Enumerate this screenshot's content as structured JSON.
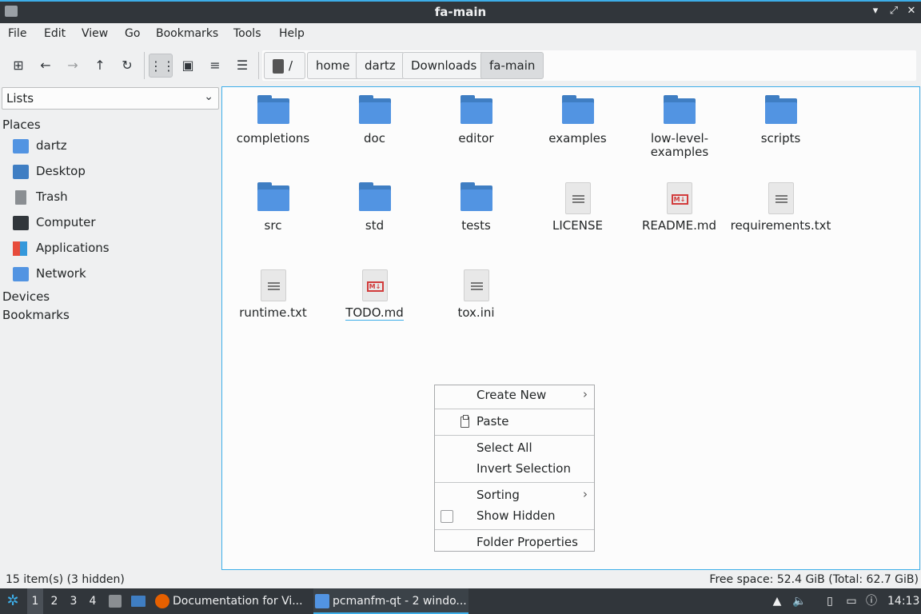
{
  "window": {
    "title": "fa-main"
  },
  "menu": {
    "items": [
      "File",
      "Edit",
      "View",
      "Go",
      "Bookmarks",
      "Tools",
      "Help"
    ]
  },
  "toolbar": {
    "buttons": [
      "new-tab-icon",
      "back-icon",
      "forward-icon",
      "up-icon",
      "reload-icon",
      "icon-view-icon",
      "thumbnail-view-icon",
      "compact-view-icon",
      "detailed-view-icon"
    ],
    "path": [
      "/",
      "home",
      "dartz",
      "Downloads",
      "fa-main"
    ]
  },
  "sidebar": {
    "selector": "Lists",
    "places_label": "Places",
    "places": [
      {
        "label": "dartz",
        "icon": "home-folder-icon"
      },
      {
        "label": "Desktop",
        "icon": "desktop-icon"
      },
      {
        "label": "Trash",
        "icon": "trash-icon"
      },
      {
        "label": "Computer",
        "icon": "computer-icon"
      },
      {
        "label": "Applications",
        "icon": "applications-icon"
      },
      {
        "label": "Network",
        "icon": "network-icon"
      }
    ],
    "devices_label": "Devices",
    "bookmarks_label": "Bookmarks"
  },
  "files": [
    {
      "name": "completions",
      "type": "folder"
    },
    {
      "name": "doc",
      "type": "folder"
    },
    {
      "name": "editor",
      "type": "folder"
    },
    {
      "name": "examples",
      "type": "folder"
    },
    {
      "name": "low-level-examples",
      "type": "folder"
    },
    {
      "name": "scripts",
      "type": "folder"
    },
    {
      "name": "src",
      "type": "folder"
    },
    {
      "name": "std",
      "type": "folder"
    },
    {
      "name": "tests",
      "type": "folder"
    },
    {
      "name": "LICENSE",
      "type": "text"
    },
    {
      "name": "README.md",
      "type": "markdown"
    },
    {
      "name": "requirements.txt",
      "type": "text"
    },
    {
      "name": "runtime.txt",
      "type": "text"
    },
    {
      "name": "TODO.md",
      "type": "markdown"
    },
    {
      "name": "tox.ini",
      "type": "text"
    }
  ],
  "context_menu": {
    "create_new": "Create New",
    "paste": "Paste",
    "select_all": "Select All",
    "invert_selection": "Invert Selection",
    "sorting": "Sorting",
    "show_hidden": "Show Hidden",
    "folder_properties": "Folder Properties"
  },
  "status": {
    "left": "15 item(s) (3 hidden)",
    "right": "Free space: 52.4 GiB (Total: 62.7 GiB)"
  },
  "taskbar": {
    "desktops": [
      "1",
      "2",
      "3",
      "4"
    ],
    "tasks": [
      "Documentation for Vi...",
      "pcmanfm-qt - 2 windo..."
    ],
    "clock": "14:13"
  },
  "colors": {
    "accent": "#3daee9",
    "folder": "#5294e2",
    "titlebar": "#31363b",
    "markdown": "#d23c3c"
  }
}
